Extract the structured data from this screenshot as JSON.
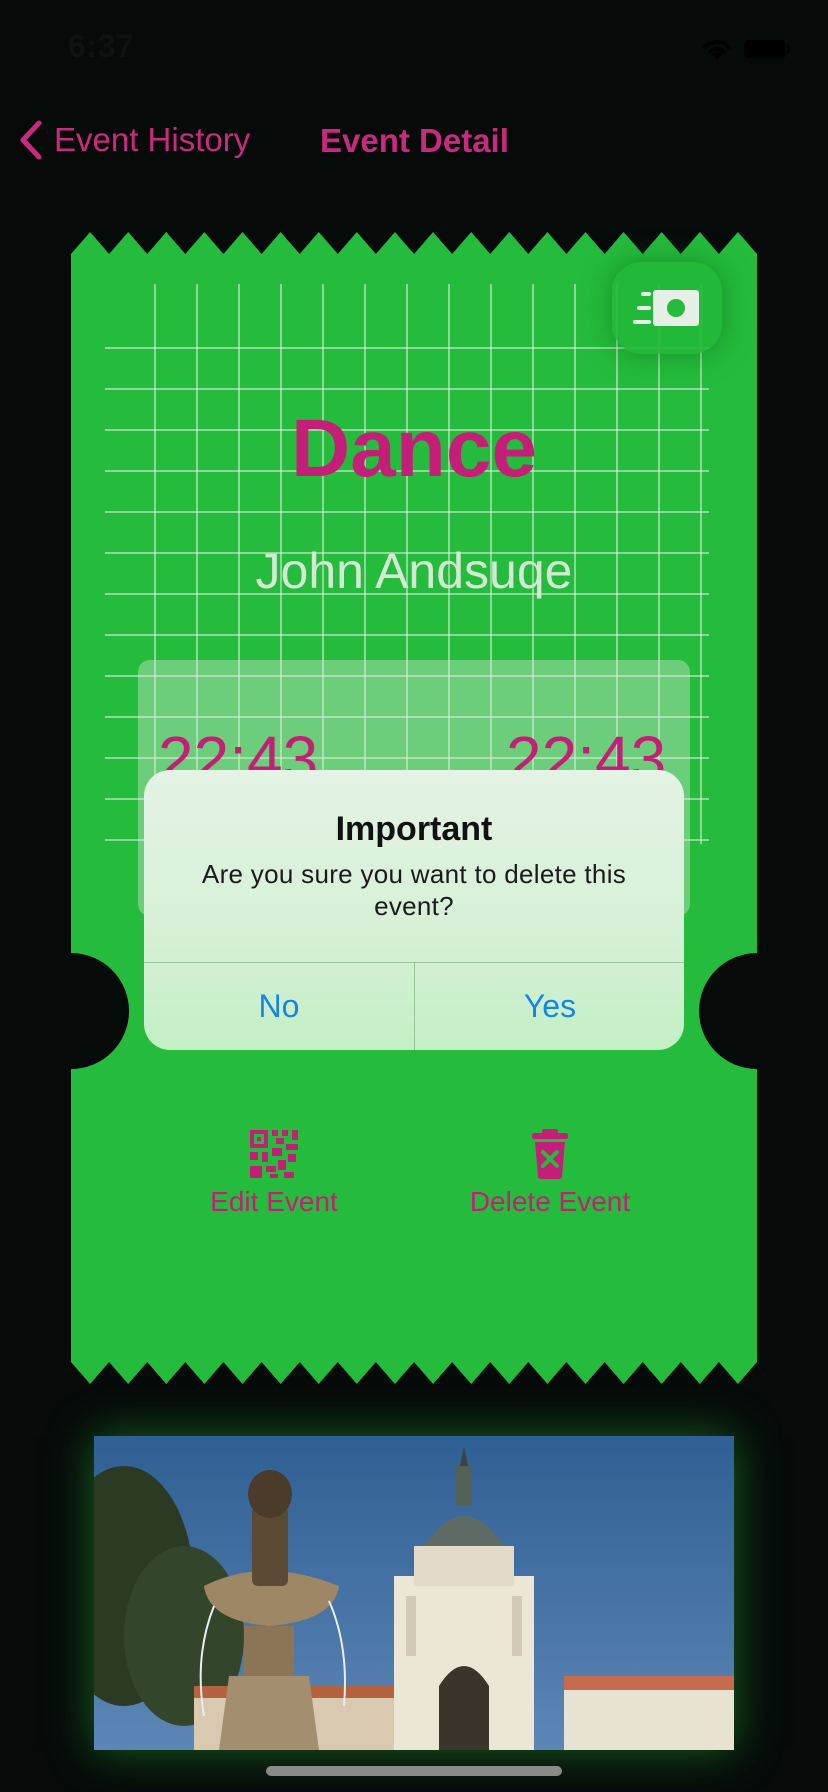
{
  "status_bar": {
    "time": "6:37"
  },
  "nav": {
    "back_label": "Event History",
    "title": "Event Detail"
  },
  "ticket": {
    "color": "#25bb3c",
    "title": "Dance",
    "person": "John Andsuqe",
    "start_time": "22:43",
    "end_time": "22:43",
    "money_icon": "money-bill-icon",
    "actions": [
      {
        "label": "Edit Event",
        "icon": "qr-code-icon"
      },
      {
        "label": "Delete Event",
        "icon": "trash-icon"
      }
    ]
  },
  "alert": {
    "title": "Important",
    "message": "Are you sure you want to delete this event?",
    "no_label": "No",
    "yes_label": "Yes"
  },
  "colors": {
    "accent": "#c41e78",
    "ticket_green": "#25bb3c",
    "alert_button": "#1585e8"
  }
}
